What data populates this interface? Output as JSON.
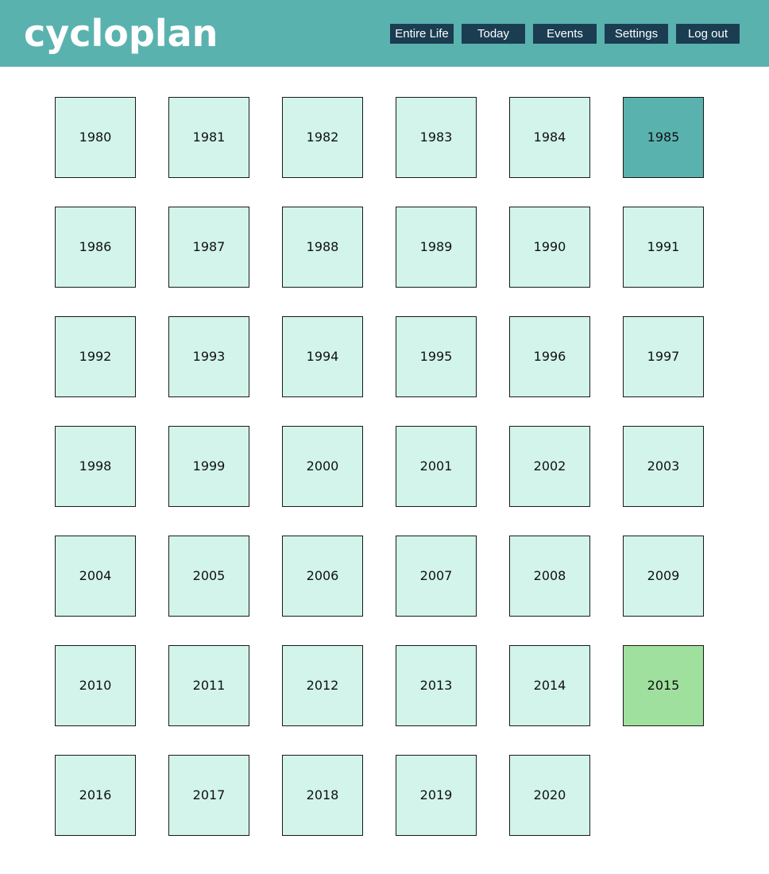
{
  "app": {
    "logo_text": "cycloplan",
    "colors": {
      "header_bg": "#5ab2af",
      "nav_button_bg": "#1b3d52",
      "year_cell_bg": "#d2f4ea",
      "year_birth_bg": "#5ab2af",
      "year_current_bg": "#9fe09e"
    }
  },
  "nav": {
    "items": [
      {
        "label": "Entire Life"
      },
      {
        "label": "Today"
      },
      {
        "label": "Events"
      },
      {
        "label": "Settings"
      },
      {
        "label": "Log out"
      }
    ]
  },
  "years": [
    {
      "label": "1980",
      "state": "normal"
    },
    {
      "label": "1981",
      "state": "normal"
    },
    {
      "label": "1982",
      "state": "normal"
    },
    {
      "label": "1983",
      "state": "normal"
    },
    {
      "label": "1984",
      "state": "normal"
    },
    {
      "label": "1985",
      "state": "birth"
    },
    {
      "label": "1986",
      "state": "normal"
    },
    {
      "label": "1987",
      "state": "normal"
    },
    {
      "label": "1988",
      "state": "normal"
    },
    {
      "label": "1989",
      "state": "normal"
    },
    {
      "label": "1990",
      "state": "normal"
    },
    {
      "label": "1991",
      "state": "normal"
    },
    {
      "label": "1992",
      "state": "normal"
    },
    {
      "label": "1993",
      "state": "normal"
    },
    {
      "label": "1994",
      "state": "normal"
    },
    {
      "label": "1995",
      "state": "normal"
    },
    {
      "label": "1996",
      "state": "normal"
    },
    {
      "label": "1997",
      "state": "normal"
    },
    {
      "label": "1998",
      "state": "normal"
    },
    {
      "label": "1999",
      "state": "normal"
    },
    {
      "label": "2000",
      "state": "normal"
    },
    {
      "label": "2001",
      "state": "normal"
    },
    {
      "label": "2002",
      "state": "normal"
    },
    {
      "label": "2003",
      "state": "normal"
    },
    {
      "label": "2004",
      "state": "normal"
    },
    {
      "label": "2005",
      "state": "normal"
    },
    {
      "label": "2006",
      "state": "normal"
    },
    {
      "label": "2007",
      "state": "normal"
    },
    {
      "label": "2008",
      "state": "normal"
    },
    {
      "label": "2009",
      "state": "normal"
    },
    {
      "label": "2010",
      "state": "normal"
    },
    {
      "label": "2011",
      "state": "normal"
    },
    {
      "label": "2012",
      "state": "normal"
    },
    {
      "label": "2013",
      "state": "normal"
    },
    {
      "label": "2014",
      "state": "normal"
    },
    {
      "label": "2015",
      "state": "current"
    },
    {
      "label": "2016",
      "state": "normal"
    },
    {
      "label": "2017",
      "state": "normal"
    },
    {
      "label": "2018",
      "state": "normal"
    },
    {
      "label": "2019",
      "state": "normal"
    },
    {
      "label": "2020",
      "state": "normal"
    }
  ]
}
